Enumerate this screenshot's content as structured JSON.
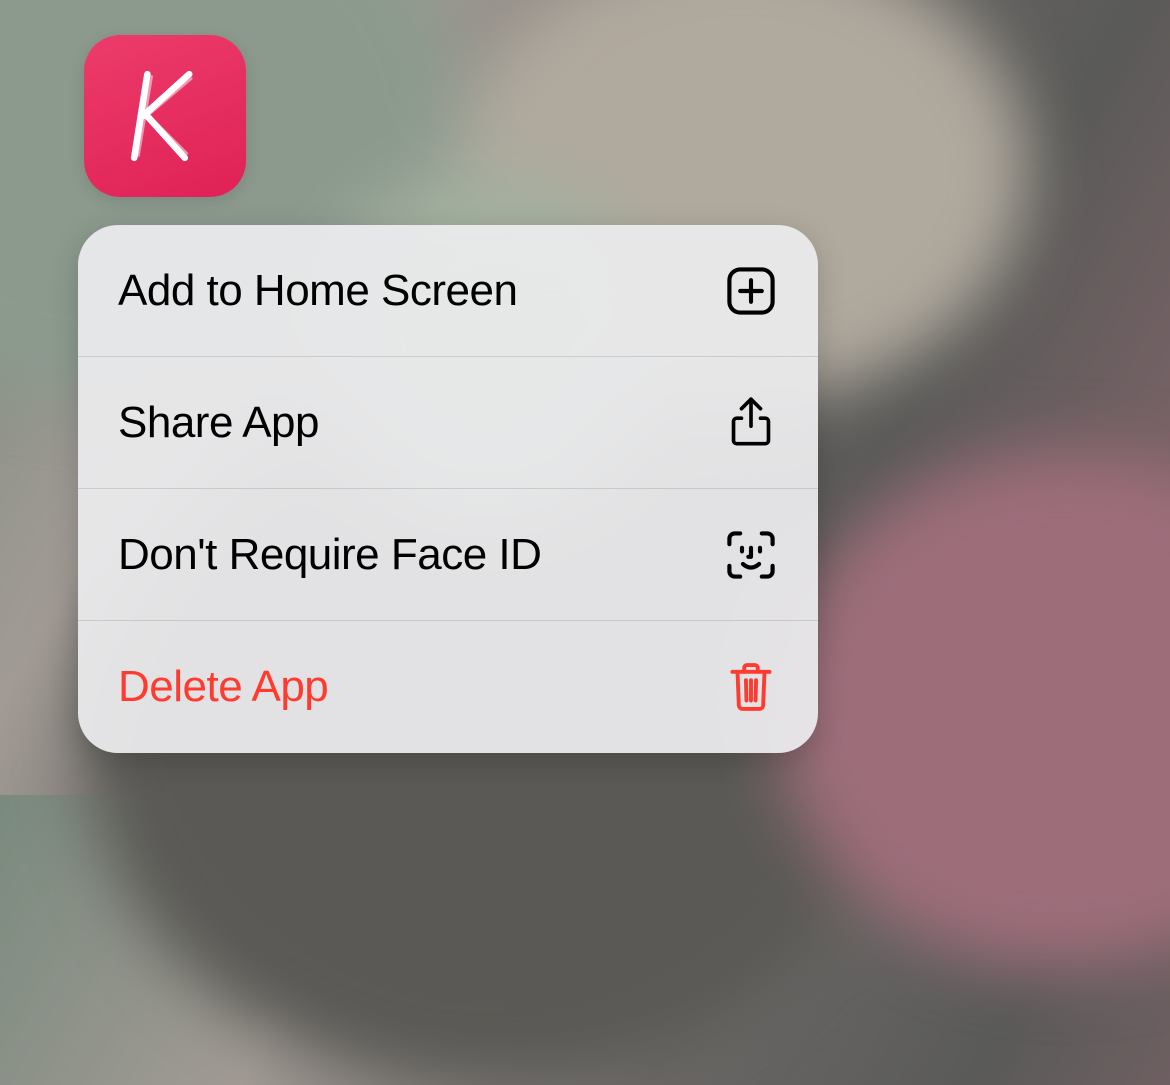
{
  "app": {
    "letter": "K",
    "accent_color": "#e02156"
  },
  "menu": {
    "items": [
      {
        "label": "Add to Home Screen",
        "icon": "plus-square-icon",
        "destructive": false
      },
      {
        "label": "Share App",
        "icon": "share-icon",
        "destructive": false
      },
      {
        "label": "Don't Require Face ID",
        "icon": "faceid-icon",
        "destructive": false
      },
      {
        "label": "Delete App",
        "icon": "trash-icon",
        "destructive": true
      }
    ],
    "destructive_color": "#ff3b30"
  }
}
